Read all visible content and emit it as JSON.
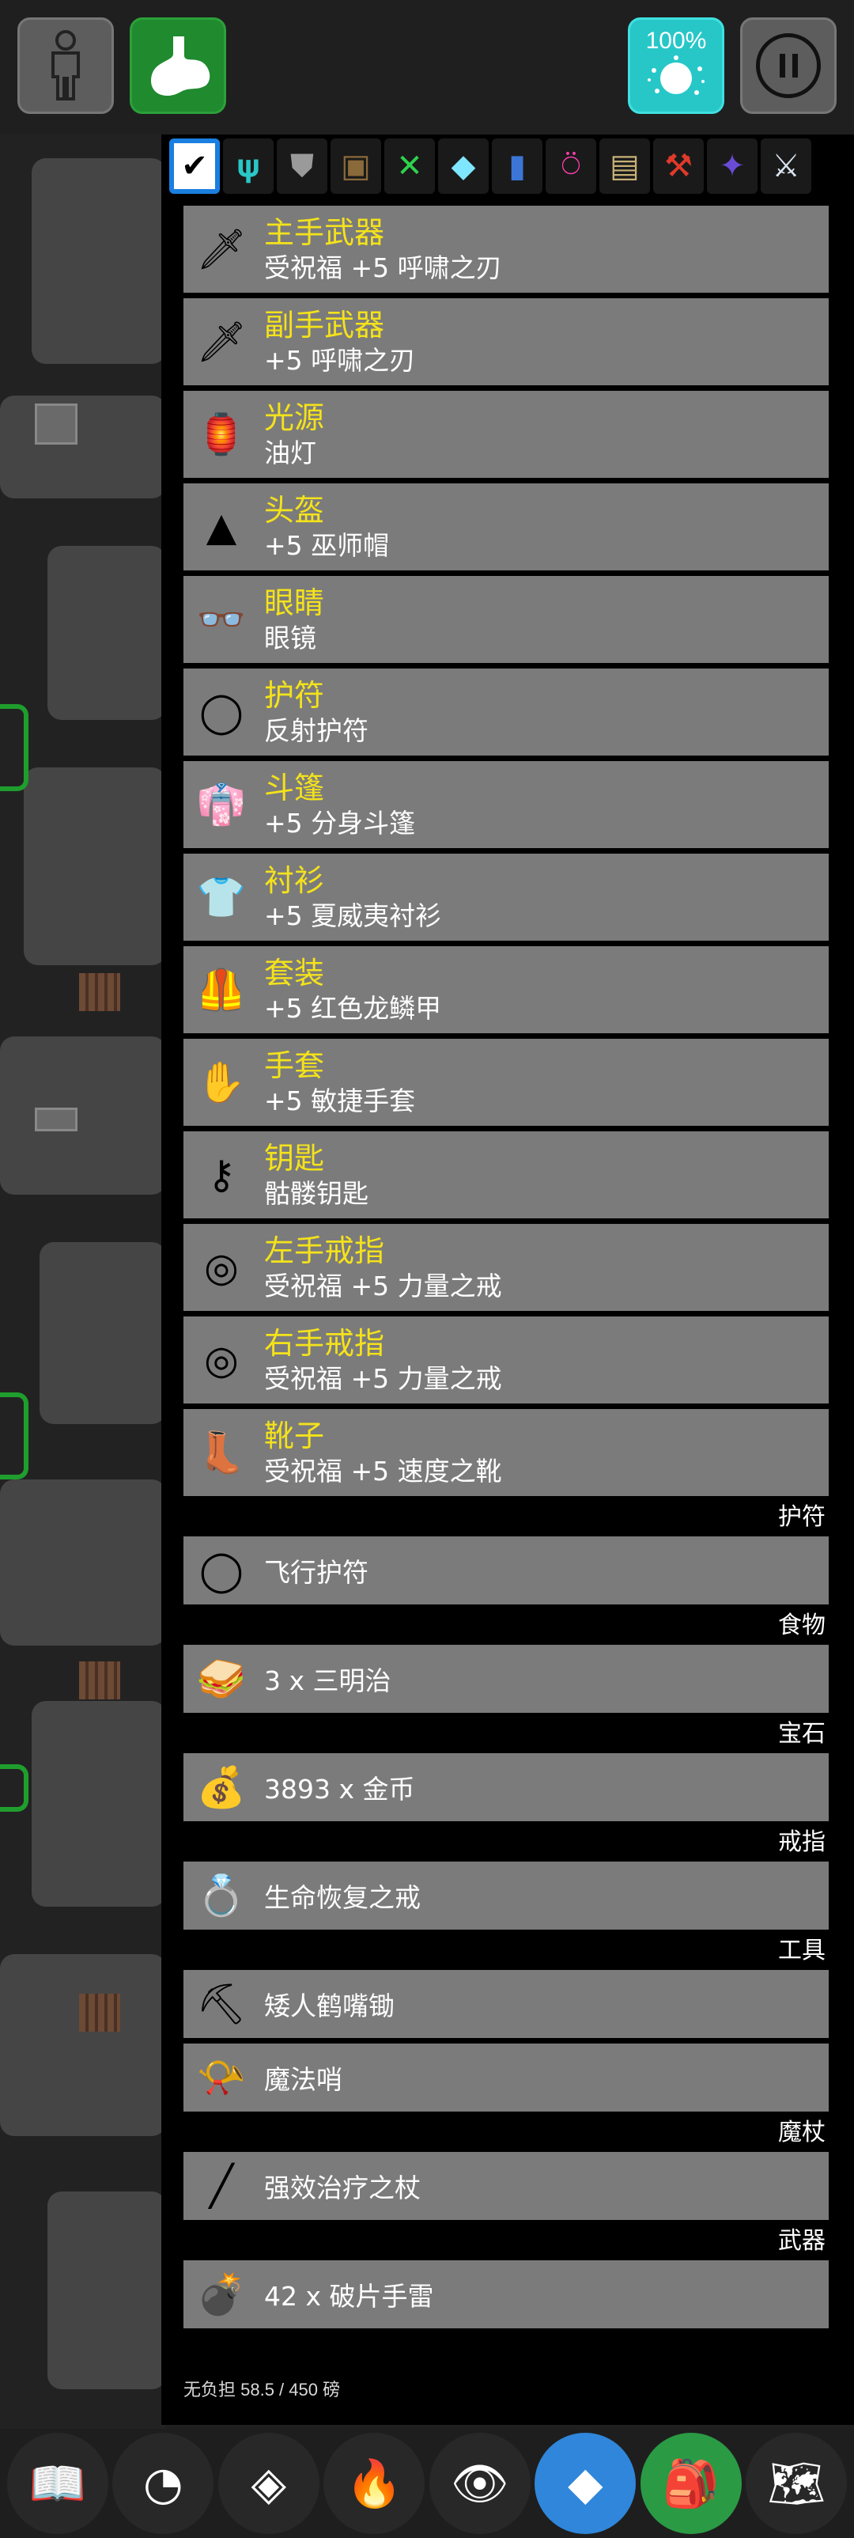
{
  "top": {
    "character_icon": "person-icon",
    "food_icon": "stomach-icon",
    "percent_label": "100%",
    "pause_icon": "pause-icon"
  },
  "filters": [
    {
      "icon": "check-icon",
      "glyph": "✔",
      "active": true,
      "color": "#000000"
    },
    {
      "icon": "amulet-icon",
      "glyph": "𝛙",
      "color": "#2bc6c6"
    },
    {
      "icon": "shield-icon",
      "glyph": "⛊",
      "color": "#9a9a9a"
    },
    {
      "icon": "armor-icon",
      "glyph": "▣",
      "color": "#8a6a3a"
    },
    {
      "icon": "food-icon",
      "glyph": "✕",
      "color": "#2fd14c"
    },
    {
      "icon": "gem-icon",
      "glyph": "◆",
      "color": "#7fe6ff"
    },
    {
      "icon": "potion-icon",
      "glyph": "▮",
      "color": "#3b76d6"
    },
    {
      "icon": "ring-icon",
      "glyph": "⍥",
      "color": "#ff3fae"
    },
    {
      "icon": "scroll-icon",
      "glyph": "▤",
      "color": "#c8b076"
    },
    {
      "icon": "tool-icon",
      "glyph": "⚒",
      "color": "#e03a2a"
    },
    {
      "icon": "wand-icon",
      "glyph": "✦",
      "color": "#6a4bd6"
    },
    {
      "icon": "weapon-icon",
      "glyph": "⚔",
      "color": "#d9e4f0"
    }
  ],
  "equipment": [
    {
      "slot": "主手武器",
      "item": "受祝福 +5 呼啸之刃",
      "icon": "knife-icon",
      "glyph": "🗡"
    },
    {
      "slot": "副手武器",
      "item": "+5 呼啸之刃",
      "icon": "knife-icon",
      "glyph": "🗡"
    },
    {
      "slot": "光源",
      "item": "油灯",
      "icon": "lamp-icon",
      "glyph": "🏮"
    },
    {
      "slot": "头盔",
      "item": "+5 巫师帽",
      "icon": "wizard-hat-icon",
      "glyph": "▲"
    },
    {
      "slot": "眼睛",
      "item": "眼镜",
      "icon": "glasses-icon",
      "glyph": "👓"
    },
    {
      "slot": "护符",
      "item": "反射护符",
      "icon": "amulet-icon",
      "glyph": "◯"
    },
    {
      "slot": "斗篷",
      "item": "+5 分身斗篷",
      "icon": "cloak-icon",
      "glyph": "👘"
    },
    {
      "slot": "衬衫",
      "item": "+5 夏威夷衬衫",
      "icon": "shirt-icon",
      "glyph": "👕"
    },
    {
      "slot": "套装",
      "item": "+5 红色龙鳞甲",
      "icon": "armor-icon",
      "glyph": "🦺"
    },
    {
      "slot": "手套",
      "item": "+5 敏捷手套",
      "icon": "glove-icon",
      "glyph": "✋"
    },
    {
      "slot": "钥匙",
      "item": "骷髅钥匙",
      "icon": "key-icon",
      "glyph": "⚷"
    },
    {
      "slot": "左手戒指",
      "item": "受祝福 +5 力量之戒",
      "icon": "ring-icon",
      "glyph": "◎"
    },
    {
      "slot": "右手戒指",
      "item": "受祝福 +5 力量之戒",
      "icon": "ring-icon",
      "glyph": "◎"
    },
    {
      "slot": "靴子",
      "item": "受祝福 +5 速度之靴",
      "icon": "boots-icon",
      "glyph": "👢"
    }
  ],
  "categories": [
    {
      "label": "护符",
      "items": [
        {
          "text": "飞行护符",
          "icon": "amulet-icon",
          "glyph": "◯"
        }
      ]
    },
    {
      "label": "食物",
      "items": [
        {
          "text": "3 x 三明治",
          "icon": "sandwich-icon",
          "glyph": "🥪"
        }
      ]
    },
    {
      "label": "宝石",
      "items": [
        {
          "text": "3893 x 金币",
          "icon": "coin-bag-icon",
          "glyph": "💰"
        }
      ]
    },
    {
      "label": "戒指",
      "items": [
        {
          "text": "生命恢复之戒",
          "icon": "ring-icon",
          "glyph": "💍"
        }
      ]
    },
    {
      "label": "工具",
      "items": [
        {
          "text": "矮人鹤嘴锄",
          "icon": "pickaxe-icon",
          "glyph": "⛏"
        },
        {
          "text": "魔法哨",
          "icon": "whistle-icon",
          "glyph": "📯"
        }
      ]
    },
    {
      "label": "魔杖",
      "items": [
        {
          "text": "强效治疗之杖",
          "icon": "wand-icon",
          "glyph": "╱"
        }
      ]
    },
    {
      "label": "武器",
      "items": [
        {
          "text": "42 x 破片手雷",
          "icon": "grenade-icon",
          "glyph": "💣"
        }
      ]
    }
  ],
  "weight": "无负担 58.5 / 450 磅",
  "toolbar": [
    {
      "icon": "book-icon",
      "glyph": "📖"
    },
    {
      "icon": "head-icon",
      "glyph": "◔"
    },
    {
      "icon": "skill-icon",
      "glyph": "◈"
    },
    {
      "icon": "campfire-icon",
      "glyph": "🔥"
    },
    {
      "icon": "look-icon",
      "glyph": "👁"
    },
    {
      "icon": "layers-icon",
      "glyph": "◆",
      "style": "blue"
    },
    {
      "icon": "inventory-bag-icon",
      "glyph": "🎒",
      "style": "green"
    },
    {
      "icon": "map-icon",
      "glyph": "🗺"
    }
  ]
}
